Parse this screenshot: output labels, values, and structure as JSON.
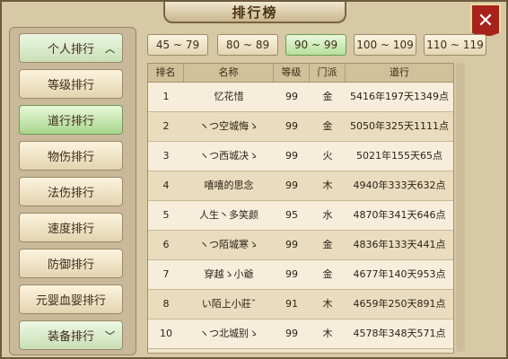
{
  "window": {
    "title": "排行榜",
    "close_label": "✕"
  },
  "sidebar": {
    "items": [
      {
        "label": "个人排行",
        "kind": "category",
        "chevron": "︿"
      },
      {
        "label": "等级排行",
        "kind": "item"
      },
      {
        "label": "道行排行",
        "kind": "item-active"
      },
      {
        "label": "物伤排行",
        "kind": "item"
      },
      {
        "label": "法伤排行",
        "kind": "item"
      },
      {
        "label": "速度排行",
        "kind": "item"
      },
      {
        "label": "防御排行",
        "kind": "item"
      },
      {
        "label": "元婴血婴排行",
        "kind": "item"
      },
      {
        "label": "装备排行",
        "kind": "category",
        "chevron": "﹀"
      }
    ]
  },
  "ranges": [
    {
      "label": "45 ~ 79",
      "active": false
    },
    {
      "label": "80 ~ 89",
      "active": false
    },
    {
      "label": "90 ~ 99",
      "active": true
    },
    {
      "label": "100 ~ 109",
      "active": false
    },
    {
      "label": "110 ~ 119",
      "active": false
    }
  ],
  "table": {
    "headers": {
      "rank": "排名",
      "name": "名称",
      "level": "等级",
      "faction": "门派",
      "daoxing": "道行"
    },
    "rows": [
      {
        "rank": "1",
        "name": "忆花惜",
        "level": "99",
        "faction": "金",
        "daoxing": "5416年197天1349点"
      },
      {
        "rank": "2",
        "name": "ヽつ空城悔ゝ",
        "level": "99",
        "faction": "金",
        "daoxing": "5050年325天1111点"
      },
      {
        "rank": "3",
        "name": "ヽつ西城决ゝ",
        "level": "99",
        "faction": "火",
        "daoxing": "5021年155天65点"
      },
      {
        "rank": "4",
        "name": "嘻嘻的思念",
        "level": "99",
        "faction": "木",
        "daoxing": "4940年333天632点"
      },
      {
        "rank": "5",
        "name": "人生丶多笑颜",
        "level": "95",
        "faction": "水",
        "daoxing": "4870年341天646点"
      },
      {
        "rank": "6",
        "name": "ヽつ陌城寒ゝ",
        "level": "99",
        "faction": "金",
        "daoxing": "4836年133天441点"
      },
      {
        "rank": "7",
        "name": "穿越ゝ小爺",
        "level": "99",
        "faction": "金",
        "daoxing": "4677年140天953点"
      },
      {
        "rank": "8",
        "name": "い陌上小莊ˇ",
        "level": "91",
        "faction": "木",
        "daoxing": "4659年250天891点"
      },
      {
        "rank": "10",
        "name": "ヽつ北城别ゝ",
        "level": "99",
        "faction": "木",
        "daoxing": "4578年348天571点"
      }
    ]
  }
}
